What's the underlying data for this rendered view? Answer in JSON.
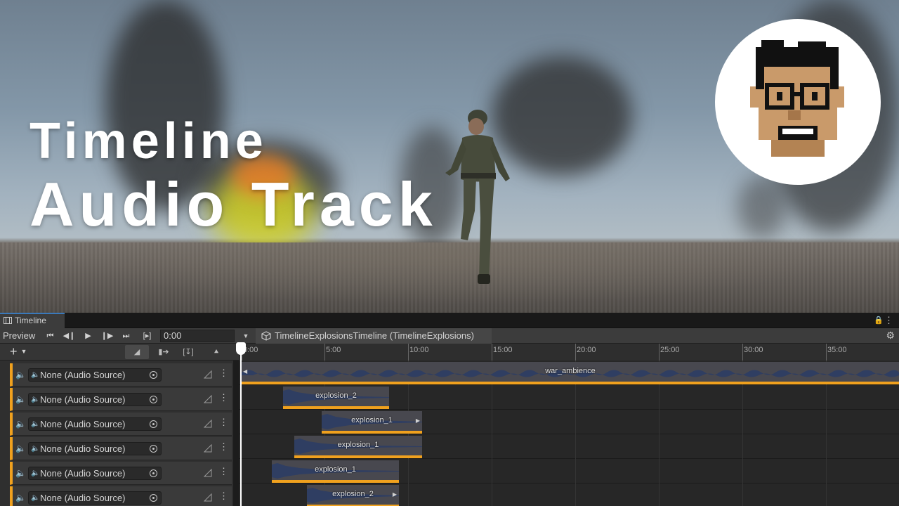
{
  "scene": {
    "title_line1": "Timeline",
    "title_line2": "Audio Track"
  },
  "timeline": {
    "tab_label": "Timeline",
    "preview_label": "Preview",
    "time_value": "0:00",
    "asset_name": "TimelineExplosionsTimeline (TimelineExplosions)",
    "ruler_ticks": [
      "0:00",
      "5:00",
      "10:00",
      "15:00",
      "20:00",
      "25:00",
      "30:00",
      "35:00"
    ],
    "tracks": [
      {
        "binding": "None (Audio Source)",
        "clips": [
          "war_ambience"
        ]
      },
      {
        "binding": "None (Audio Source)",
        "clips": [
          "explosion_2"
        ]
      },
      {
        "binding": "None (Audio Source)",
        "clips": [
          "explosion_1"
        ]
      },
      {
        "binding": "None (Audio Source)",
        "clips": [
          "explosion_1"
        ]
      },
      {
        "binding": "None (Audio Source)",
        "clips": [
          "explosion_1"
        ]
      },
      {
        "binding": "None (Audio Source)",
        "clips": [
          "explosion_2"
        ]
      }
    ]
  },
  "colors": {
    "accent_audio": "#f0a11e",
    "tab_highlight": "#3a79bb"
  },
  "icons": {
    "transport": [
      "skip-start-icon",
      "prev-frame-icon",
      "play-icon",
      "next-frame-icon",
      "skip-end-icon",
      "play-range-icon"
    ],
    "track": [
      "speaker-icon",
      "object-picker-icon",
      "curves-icon",
      "track-menu-icon"
    ]
  }
}
